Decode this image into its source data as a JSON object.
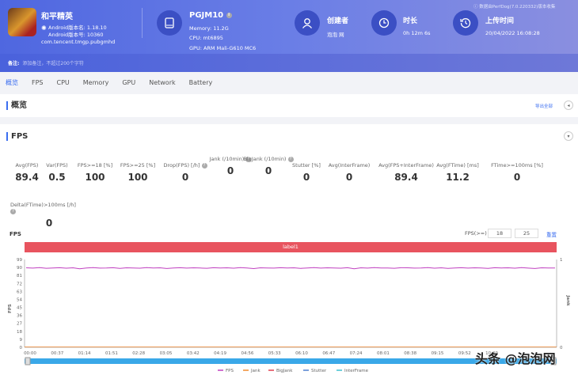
{
  "app": {
    "name": "和平精英",
    "version_name": "Android版本名: 1.18.10",
    "version_code": "Android版本号: 10360",
    "package": "com.tencent.tmgp.pubgmhd"
  },
  "device": {
    "model": "PGJM10",
    "memory": "Memory: 11.2G",
    "cpu": "CPU: mt6895",
    "gpu": "GPU: ARM Mali-G610 MC6"
  },
  "creator": {
    "label": "创建者",
    "value": "泡泡 网"
  },
  "duration": {
    "label": "时长",
    "value": "0h 12m 6s"
  },
  "upload": {
    "label": "上传时间",
    "value": "20/04/2022 16:08:28"
  },
  "source_note": "ⓘ 数据由PerfDog(7.0.220332)版本收集",
  "note": {
    "label": "备注:",
    "placeholder": "添加备注，不超过200个字符"
  },
  "nav": [
    "概览",
    "FPS",
    "CPU",
    "Memory",
    "GPU",
    "Network",
    "Battery"
  ],
  "overview": {
    "title": "概览",
    "export": "导出全部"
  },
  "fps_section": {
    "title": "FPS"
  },
  "metrics": [
    {
      "label": "Avg(FPS)",
      "value": "89.4"
    },
    {
      "label": "Var(FPS)",
      "value": "0.5"
    },
    {
      "label": "FPS>=18 [%]",
      "value": "100"
    },
    {
      "label": "FPS>=25 [%]",
      "value": "100"
    },
    {
      "label": "Drop(FPS) [/h]",
      "value": "0"
    },
    {
      "label": "Jank (/10min)",
      "value": "0"
    },
    {
      "label": "BigJank (/10min)",
      "value": "0"
    },
    {
      "label": "Stutter [%]",
      "value": "0"
    },
    {
      "label": "Avg(InterFrame)",
      "value": "0"
    },
    {
      "label": "Avg(FPS+InterFrame)",
      "value": "89.4"
    },
    {
      "label": "Avg(FTime) [ms]",
      "value": "11.2"
    },
    {
      "label": "FTime>=100ms [%]",
      "value": "0"
    },
    {
      "label": "Delta(FTime)>100ms [/h]",
      "value": "0"
    }
  ],
  "chart_controls": {
    "title": "FPS",
    "threshold_label": "FPS(>=)",
    "threshold1": "18",
    "threshold2": "25",
    "reset": "重置",
    "band_label": "label1"
  },
  "watermark": "头条 @泡泡网",
  "chart_data": {
    "type": "line",
    "title": "FPS",
    "ylabel": "FPS",
    "y2label": "Jank",
    "ylim": [
      0,
      99
    ],
    "y2lim": [
      0,
      1
    ],
    "yticks": [
      "99",
      "90",
      "81",
      "72",
      "63",
      "54",
      "45",
      "36",
      "27",
      "18",
      "9",
      "0"
    ],
    "y2ticks": [
      "1",
      "0"
    ],
    "xticks": [
      "00:00",
      "00:37",
      "01:14",
      "01:51",
      "02:28",
      "03:05",
      "03:42",
      "04:19",
      "04:56",
      "05:33",
      "06:10",
      "06:47",
      "07:24",
      "08:01",
      "08:38",
      "09:15",
      "09:52",
      "10:29"
    ],
    "legend": [
      "FPS",
      "Jank",
      "BigJank",
      "Stutter",
      "InterFrame"
    ],
    "legend_colors": [
      "#c040c0",
      "#f08a30",
      "#e04050",
      "#5080d0",
      "#40c0d0"
    ],
    "series": [
      {
        "name": "FPS",
        "values": [
          89.6,
          89.3,
          89.8,
          89.1,
          89.5,
          89.7,
          89.2,
          89.6,
          88.6,
          89.5,
          89.8,
          89.3,
          89.4,
          89.7,
          89.0,
          89.6,
          89.5,
          89.2,
          89.8,
          89.4,
          89.6,
          88.8,
          89.5,
          89.7,
          89.3,
          89.6,
          89.4,
          89.1,
          89.7,
          89.5,
          89.6,
          89.2,
          89.8,
          89.4,
          88.7,
          89.6,
          89.5,
          89.3,
          89.7,
          89.4,
          89.6,
          89.0,
          89.5,
          89.8,
          89.3,
          89.6,
          89.4,
          89.2,
          89.7,
          88.5,
          89.6,
          89.3,
          89.8,
          89.4,
          89.5,
          89.1,
          89.7,
          89.6,
          89.3,
          89.4,
          89.8,
          89.2,
          89.6,
          88.9,
          89.5,
          89.7,
          89.3,
          89.6,
          89.4,
          89.0,
          89.7,
          89.5,
          89.6,
          89.2,
          89.8,
          89.3,
          88.8,
          89.6,
          89.5,
          89.4
        ]
      },
      {
        "name": "Jank",
        "values": [
          0
        ]
      },
      {
        "name": "BigJank",
        "values": [
          0
        ]
      },
      {
        "name": "Stutter",
        "values": [
          0
        ]
      },
      {
        "name": "InterFrame",
        "values": [
          0
        ]
      }
    ]
  }
}
